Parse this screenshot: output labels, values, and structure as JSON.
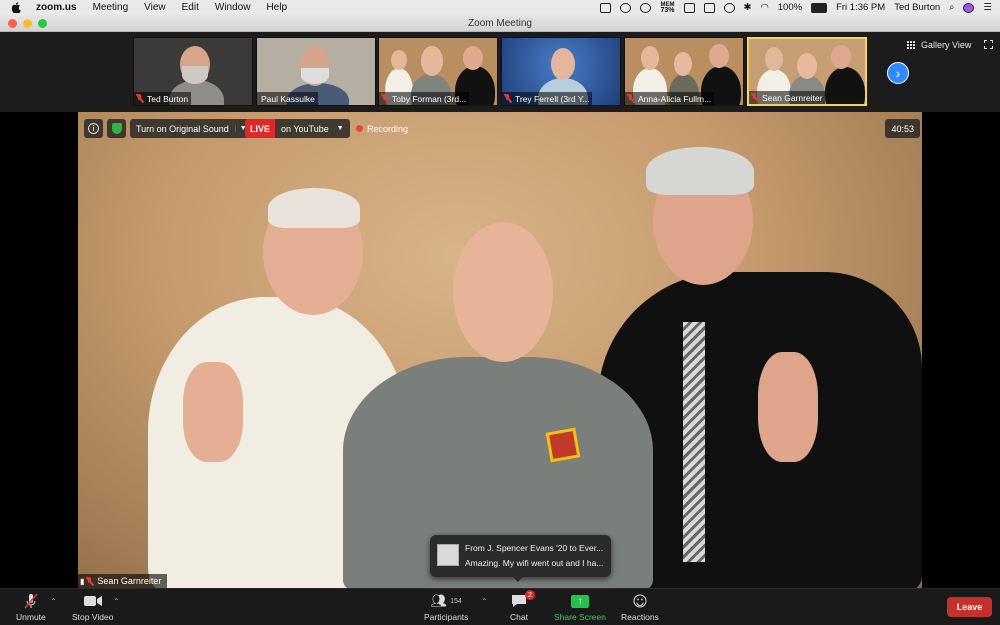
{
  "menubar": {
    "app": "zoom.us",
    "items": [
      "Meeting",
      "View",
      "Edit",
      "Window",
      "Help"
    ],
    "mem_label": "MEM",
    "mem_value": "73%",
    "battery": "100%",
    "clock": "Fri 1:36 PM",
    "user": "Ted Burton"
  },
  "window": {
    "title": "Zoom Meeting"
  },
  "gallery": {
    "thumbnails": [
      {
        "name": "Ted Burton",
        "muted": true
      },
      {
        "name": "Paul Kassulke",
        "muted": false
      },
      {
        "name": "Toby Forman (3rd...",
        "muted": true
      },
      {
        "name": "Trey Ferrell (3rd Y...",
        "muted": true
      },
      {
        "name": "Anna-Alicia Fullm...",
        "muted": true
      },
      {
        "name": "Sean Garnreiter",
        "muted": true,
        "active": true
      }
    ],
    "view_label": "Gallery View"
  },
  "video": {
    "sound_button": "Turn on Original Sound",
    "live_badge": "LIVE",
    "live_target": "on YouTube",
    "recording": "Recording",
    "timer": "40:53",
    "speaker_name": "Sean Garnreiter"
  },
  "chat_toast": {
    "from": "From J. Spencer Evans '20 to Ever...",
    "message": "Amazing. My wifi went out and I ha..."
  },
  "toolbar": {
    "unmute": "Unmute",
    "stop_video": "Stop Video",
    "participants": "Participants",
    "participant_count": "154",
    "chat": "Chat",
    "chat_badge": "2",
    "share_screen": "Share Screen",
    "reactions": "Reactions",
    "leave": "Leave"
  },
  "colors": {
    "accent_blue": "#2d8cff",
    "leave_red": "#c4302b",
    "live_red": "#e02828",
    "share_green": "#24c24a",
    "active_border": "#f6d35a"
  }
}
